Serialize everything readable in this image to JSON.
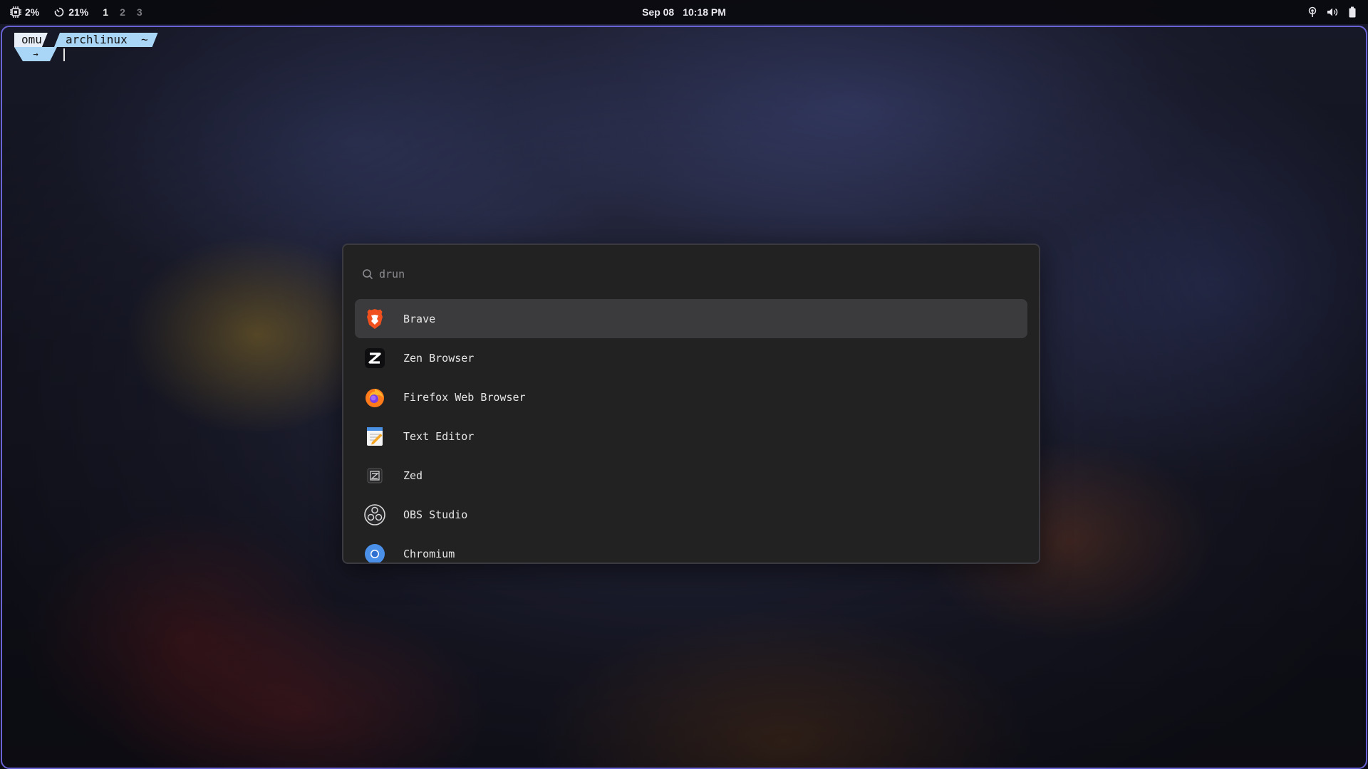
{
  "topbar": {
    "cpu": "2%",
    "memory": "21%",
    "workspaces": [
      "1",
      "2",
      "3"
    ],
    "active_workspace": "1",
    "date": "Sep 08",
    "time": "10:18 PM",
    "icons": [
      "cpu-icon",
      "memory-icon",
      "network-icon",
      "volume-icon",
      "battery-icon"
    ]
  },
  "terminal": {
    "user": "omu",
    "host": "archlinux  ~",
    "arrow": "→"
  },
  "launcher": {
    "search_placeholder": "drun",
    "search_value": "",
    "items": [
      {
        "label": "Brave",
        "icon": "brave-icon",
        "selected": true
      },
      {
        "label": "Zen Browser",
        "icon": "zen-browser-icon"
      },
      {
        "label": "Firefox Web Browser",
        "icon": "firefox-icon"
      },
      {
        "label": "Text Editor",
        "icon": "text-editor-icon"
      },
      {
        "label": "Zed",
        "icon": "zed-icon"
      },
      {
        "label": "OBS Studio",
        "icon": "obs-studio-icon"
      },
      {
        "label": "Chromium",
        "icon": "chromium-icon"
      }
    ]
  },
  "colors": {
    "frame_border": "#6a63d6",
    "launcher_bg": "#222223",
    "selected_row": "#3b3b3d"
  }
}
